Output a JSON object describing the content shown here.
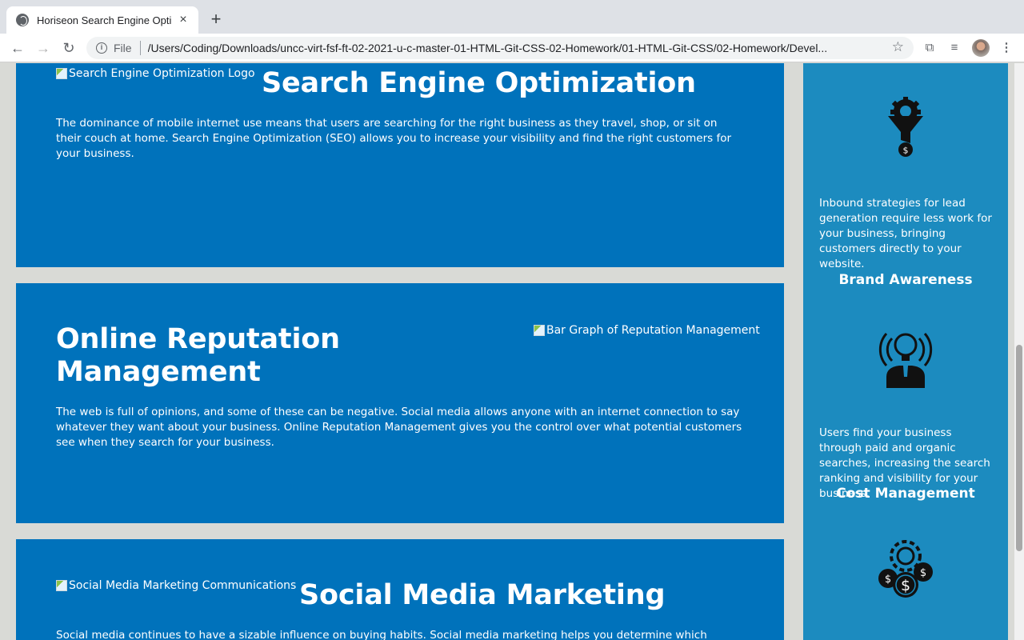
{
  "browser": {
    "tab_title": "Horiseon Search Engine Optim",
    "tab_close": "×",
    "new_tab": "+",
    "back": "←",
    "forward": "→",
    "reload": "↻",
    "info": "i",
    "file_label": "File",
    "url": "/Users/Coding/Downloads/uncc-virt-fsf-ft-02-2021-u-c-master-01-HTML-Git-CSS-02-Homework/01-HTML-Git-CSS/02-Homework/Devel...",
    "star": "☆",
    "extensions": "⧉",
    "media": "≡",
    "menu": "⋮"
  },
  "sections": {
    "seo": {
      "img_alt": "Search Engine Optimization Logo",
      "title": "Search Engine Optimization",
      "body": "The dominance of mobile internet use means that users are searching for the right business as they travel, shop, or sit on their couch at home. Search Engine Optimization (SEO) allows you to increase your visibility and find the right customers for your business."
    },
    "orm": {
      "img_alt": "Bar Graph of Reputation Management",
      "title": "Online Reputation Management",
      "body": "The web is full of opinions, and some of these can be negative. Social media allows anyone with an internet connection to say whatever they want about your business. Online Reputation Management gives you the control over what potential customers see when they search for your business."
    },
    "smm": {
      "img_alt": "Social Media Marketing Communications",
      "title": "Social Media Marketing",
      "body": "Social media continues to have a sizable influence on buying habits. Social media marketing helps you determine which platforms are"
    }
  },
  "sidebar": {
    "lead_text": "Inbound strategies for lead generation require less work for your business, bringing customers directly to your website.",
    "brand_heading": "Brand Awareness",
    "brand_text": "Users find your business through paid and organic searches, increasing the search ranking and visibility for your business.",
    "cost_heading": "Cost Management",
    "icons": [
      "lead-generation-funnel-icon",
      "brand-awareness-bulb-icon",
      "cost-management-coins-icon"
    ]
  },
  "colors": {
    "card_bg": "#0072bb",
    "sidebar_bg": "#1c8bbf",
    "page_bg": "#d9dad6"
  }
}
